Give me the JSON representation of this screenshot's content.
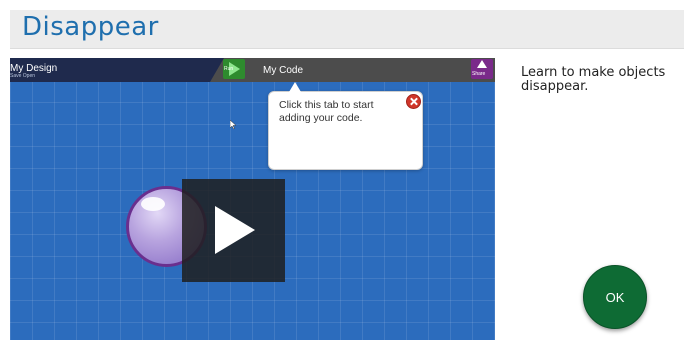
{
  "page": {
    "title": "Disappear",
    "description": "Learn to make objects disappear.",
    "ok_label": "OK"
  },
  "video": {
    "design_tab_label": "My Design",
    "design_tab_sublabel": "Save   Open",
    "code_tab_label": "My Code",
    "run_label": "Run",
    "share_label": "Share",
    "tooltip_text": "Click this tab to start adding your code."
  },
  "colors": {
    "title": "#1f6fae",
    "stage": "#2c6cbd",
    "ok_button": "#0e6b34",
    "bubble_border": "#6a2f8e"
  },
  "icons": [
    "play-icon",
    "close-icon",
    "run-icon",
    "share-icon",
    "cursor-icon"
  ]
}
